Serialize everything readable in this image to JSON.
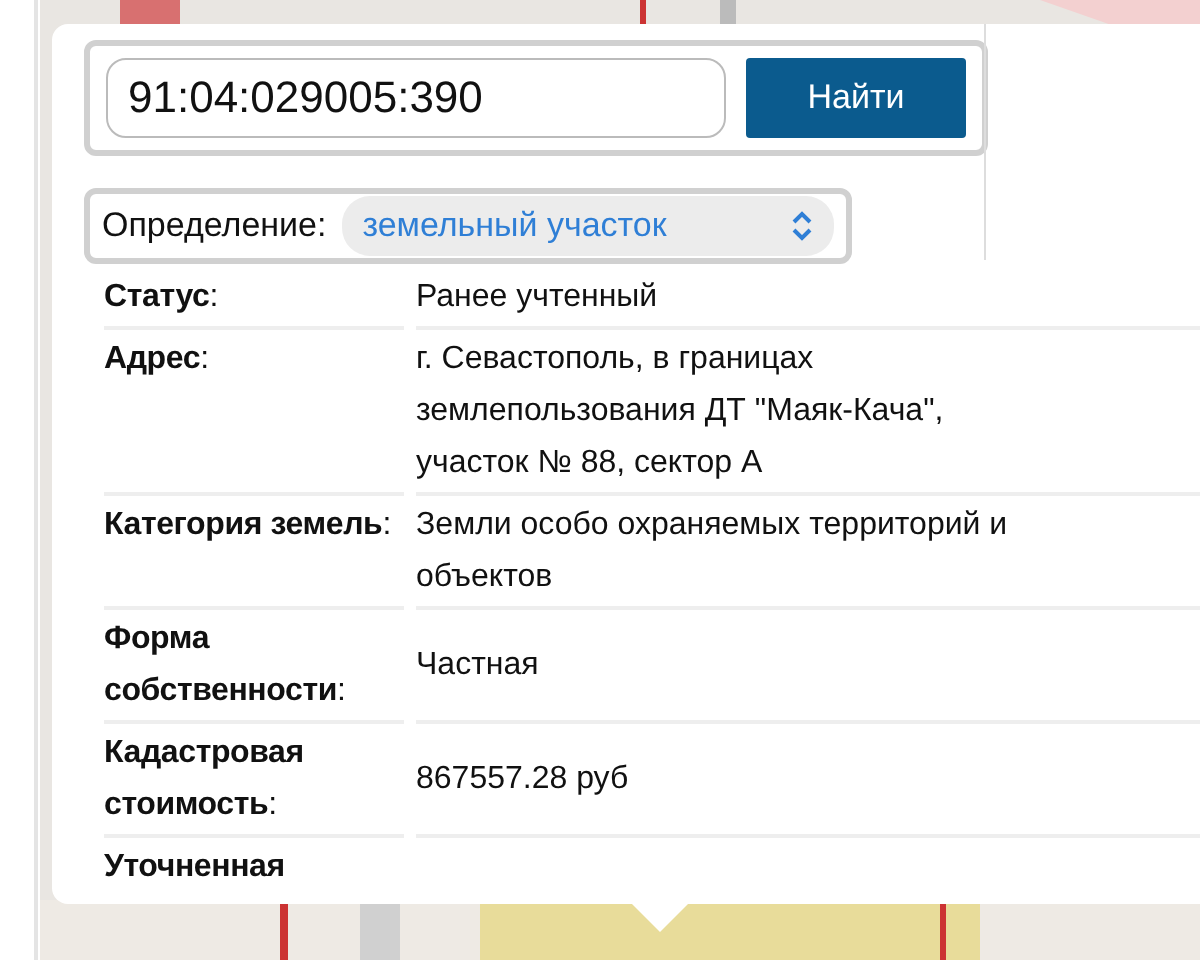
{
  "search": {
    "value": "91:04:029005:390",
    "button": "Найти"
  },
  "definition": {
    "label": "Определение:",
    "value": "земельный участок"
  },
  "details": [
    {
      "label": "**Статус**:",
      "value": "Ранее учтенный"
    },
    {
      "label": "**Адрес**:",
      "value": "г. Севастополь, в границах землепользования ДТ \"Маяк-Кача\", участок № 88, сектор А"
    },
    {
      "label": "**Категория земель**:",
      "value": "Земли особо охраняемых территорий и объектов"
    },
    {
      "label": "**Форма собственности**:",
      "value": "Частная"
    },
    {
      "label": "**Кадастровая стоимость**:",
      "value": "867557.28 руб"
    },
    {
      "label": "**Уточненная**"
    }
  ]
}
